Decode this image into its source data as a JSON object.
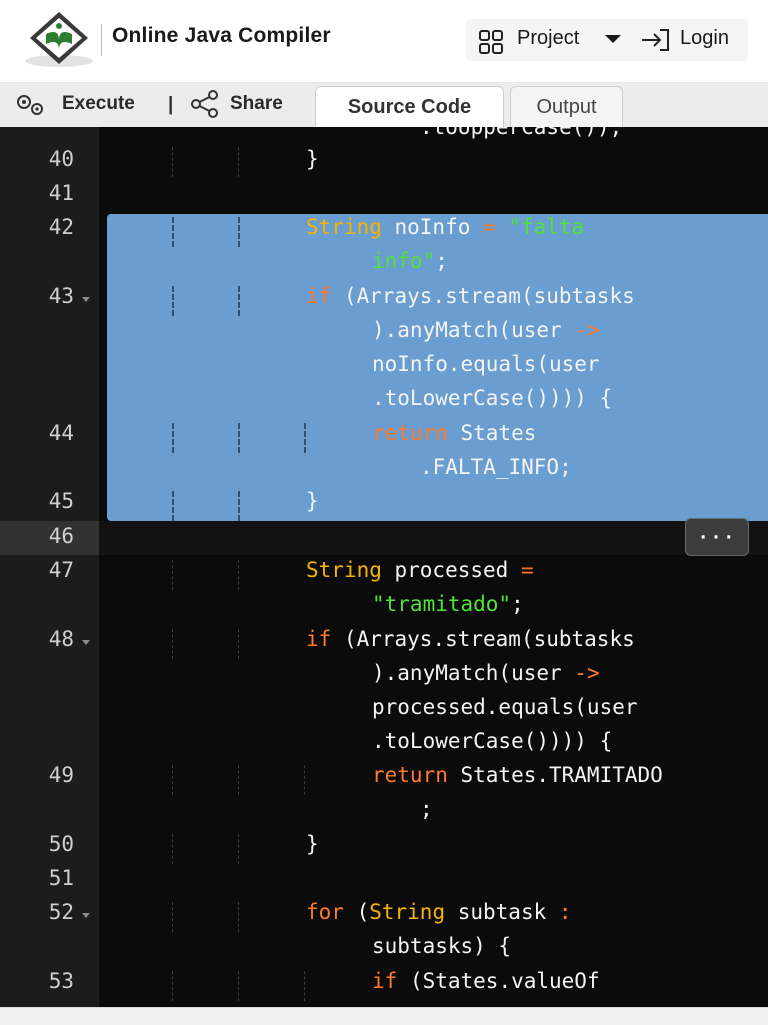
{
  "header": {
    "title": "Online Java Compiler",
    "project_label": "Project",
    "login_label": "Login",
    "logo_icon": "tutorialspoint-logo-icon"
  },
  "toolbar": {
    "execute_label": "Execute",
    "separator": "|",
    "share_label": "Share",
    "tabs": [
      {
        "label": "Source Code",
        "active": true
      },
      {
        "label": "Output",
        "active": false
      }
    ]
  },
  "editor": {
    "line_numbers": [
      "40",
      "41",
      "42",
      "43",
      "44",
      "45",
      "46",
      "47",
      "48",
      "49",
      "50",
      "51",
      "52",
      "53"
    ],
    "partial_top_line": ".toUpperCase());",
    "code": {
      "l40": "}",
      "l42_type": "String",
      "l42_rest": " noInfo ",
      "l42_eq": "=",
      "l42_str": " \"falta",
      "l42b_str": "info\"",
      "l42b_end": ";",
      "l43_kw": "if",
      "l43_rest": " (Arrays.stream(subtasks",
      "l43b_a": ").anyMatch(user ",
      "l43b_arrow": "->",
      "l43c": "noInfo.equals(user",
      "l43d": ".toLowerCase()))) {",
      "l44_kw": "return",
      "l44_rest": " States",
      "l44b": ".FALTA_INFO;",
      "l45": "}",
      "l47_type": "String",
      "l47_rest": " processed ",
      "l47_eq": "=",
      "l47b_str": "\"tramitado\"",
      "l47b_end": ";",
      "l48_kw": "if",
      "l48_rest": " (Arrays.stream(subtasks",
      "l48b_a": ").anyMatch(user ",
      "l48b_arrow": "->",
      "l48c": "processed.equals(user",
      "l48d": ".toLowerCase()))) {",
      "l49_kw": "return",
      "l49_rest": " States.TRAMITADO",
      "l49b": ";",
      "l50": "}",
      "l52_kw": "for",
      "l52_a": " (",
      "l52_type": "String",
      "l52_b": " subtask ",
      "l52_colon": ":",
      "l52c": "subtasks) {",
      "l53_kw": "if",
      "l53_rest": " (States.valueOf"
    },
    "overflow_menu_label": "···"
  },
  "colors": {
    "keyword": "#ff7a2a",
    "type": "#f5b400",
    "string": "#53e03b",
    "selection": "#6a9dd0",
    "editor_bg": "#0b0b0b"
  }
}
